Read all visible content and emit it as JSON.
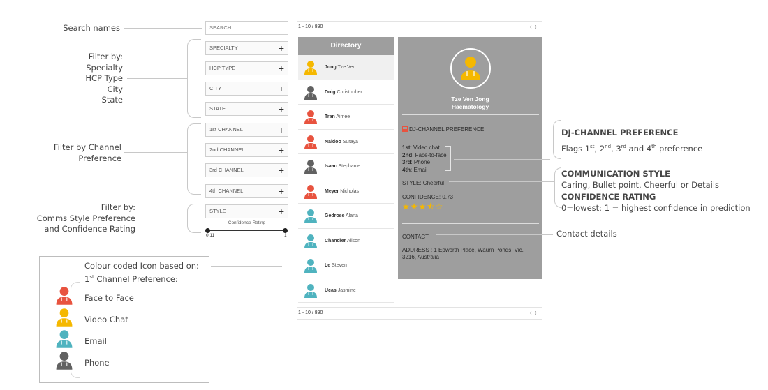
{
  "annotations": {
    "search_names": "Search names",
    "filter_by_lines": [
      "Filter by:",
      "Specialty",
      "HCP Type",
      "City",
      "State"
    ],
    "filter_channel_lines": [
      "Filter by Channel",
      "Preference"
    ],
    "filter_style_lines": [
      "Filter by:",
      "Comms Style Preference",
      "and Confidence Rating"
    ],
    "dj_title": "DJ-CHANNEL PREFERENCE",
    "dj_desc": {
      "a": "Flags 1",
      "s1": "st",
      "b": ", 2",
      "s2": "nd",
      "c": ", 3",
      "s3": "rd",
      "d": " and 4",
      "s4": "th",
      "e": " preference"
    },
    "comm_title": "COMMUNICATION STYLE",
    "comm_desc": "Caring, Bullet point, Cheerful or Details",
    "conf_title": "CONFIDENCE RATING",
    "conf_desc": "0=lowest; 1 = highest confidence in prediction",
    "contact_details": "Contact details"
  },
  "legend": {
    "line1": "Colour coded Icon based on:",
    "line2_a": "1",
    "line2_sup": "st",
    "line2_b": " Channel Preference:",
    "items": [
      {
        "label": "Face to Face",
        "color": "#e8533f"
      },
      {
        "label": "Video Chat",
        "color": "#f5b800"
      },
      {
        "label": "Email",
        "color": "#4fb3bf"
      },
      {
        "label": "Phone",
        "color": "#616161"
      }
    ]
  },
  "filters": {
    "search_placeholder": "SEARCH",
    "boxes": [
      "SPECIALTY",
      "HCP TYPE",
      "CITY",
      "STATE",
      "1st CHANNEL",
      "2nd CHANNEL",
      "3rd CHANNEL",
      "4th CHANNEL",
      "STYLE"
    ],
    "plus": "+",
    "confidence_label": "Confidence Rating",
    "confidence_min": "0.11",
    "confidence_max": "1"
  },
  "pager": {
    "range": "1 - 10 / 890",
    "prev": "‹",
    "next": "›"
  },
  "directory": {
    "title": "Directory",
    "rows": [
      {
        "last": "Jong",
        "first": "Tze Ven",
        "color": "#f5b800",
        "selected": true
      },
      {
        "last": "Doig",
        "first": "Christopher",
        "color": "#616161"
      },
      {
        "last": "Tran",
        "first": "Aimee",
        "color": "#e8533f"
      },
      {
        "last": "Naidoo",
        "first": "Suraya",
        "color": "#e8533f"
      },
      {
        "last": "Isaac",
        "first": "Stephanie",
        "color": "#616161"
      },
      {
        "last": "Meyer",
        "first": "Nicholas",
        "color": "#e8533f"
      },
      {
        "last": "Gedrose",
        "first": "Alana",
        "color": "#4fb3bf"
      },
      {
        "last": "Chandler",
        "first": "Alison",
        "color": "#4fb3bf"
      },
      {
        "last": "Le",
        "first": "Steven",
        "color": "#4fb3bf"
      },
      {
        "last": "Ucas",
        "first": "Jasmine",
        "color": "#4fb3bf"
      }
    ]
  },
  "detail": {
    "name": "Tze Ven Jong",
    "specialty": "Haematology",
    "avatar_color": "#f5b800",
    "dj_heading": "DJ-CHANNEL PREFERENCE:",
    "channels": [
      {
        "rank": "1st",
        "value": ": Video chat"
      },
      {
        "rank": "2nd",
        "value": ": Face-to-face"
      },
      {
        "rank": "3rd",
        "value": ": Phone"
      },
      {
        "rank": "4th",
        "value": ": Email"
      }
    ],
    "style_label": "STYLE",
    "style_value": ": Cheerful",
    "confidence_label": "CONFIDENCE",
    "confidence_value": ": 0.73",
    "stars": "★★★⯪☆",
    "contact_heading": "CONTACT",
    "address_label": "ADDRESS",
    "address_line1": " : 1 Epworth Place, Waurn Ponds, Vic.",
    "address_line2": "3216, Australia"
  }
}
